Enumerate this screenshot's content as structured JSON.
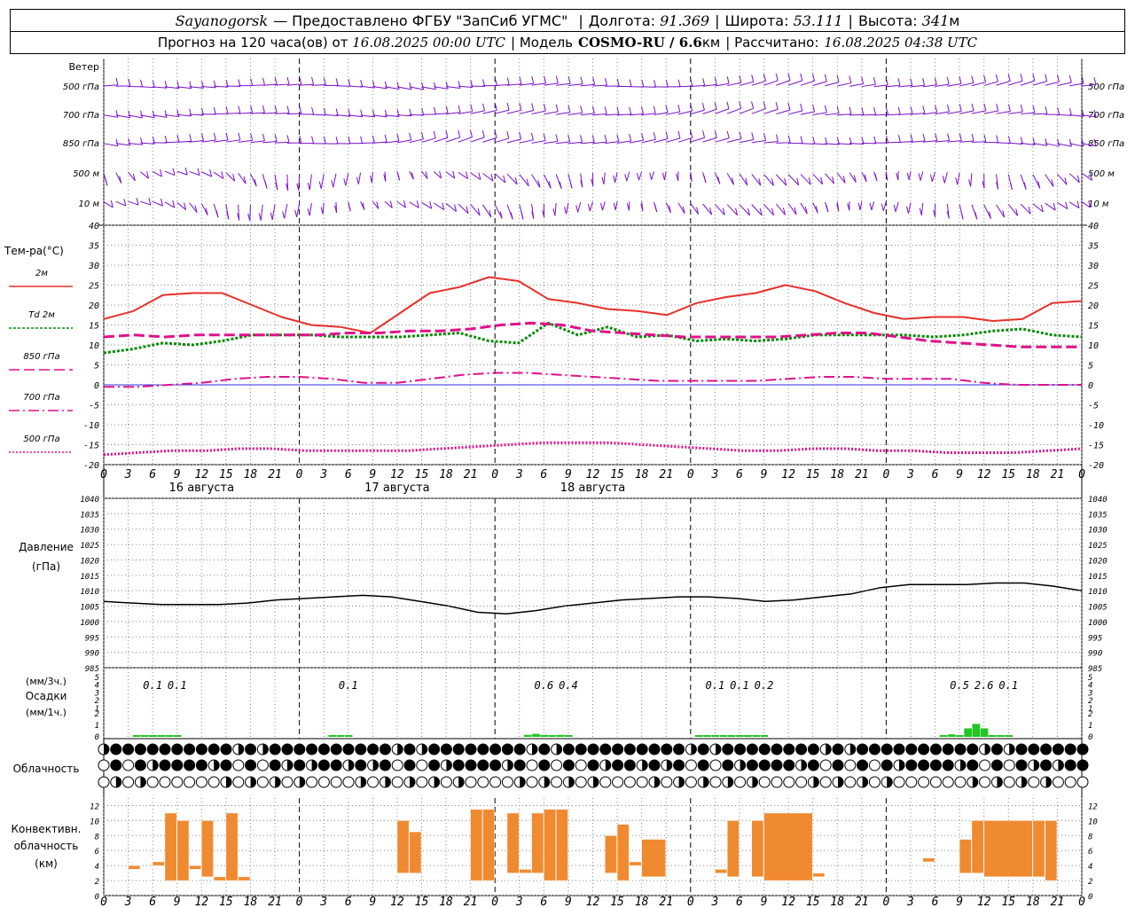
{
  "header": {
    "station": "Sayanogorsk",
    "provider": "— Предоставлено ФГБУ \"ЗапСиб УГМС\"",
    "lon_label": "Долгота:",
    "lon_value": "91.369",
    "lat_label": "Широта:",
    "lat_value": "53.111",
    "alt_label": "Высота:",
    "alt_value": "341",
    "alt_unit": "м",
    "forecast_label": "Прогноз на 120 часа(ов) от",
    "forecast_start": "16.08.2025 00:00 UTC",
    "model_label": "| Модель",
    "model_name": "COSMO-RU / 6.6",
    "model_unit": "км",
    "computed_label": "| Рассчитано:",
    "computed_time": "16.08.2025 04:38 UTC"
  },
  "colors": {
    "t2m": "#e8302a",
    "td2m": "#0a8a0a",
    "t850": "#e0108a",
    "t700": "#e0108a",
    "t500": "#e0108a",
    "wind": "#7a10c8",
    "pressure": "#000000",
    "precip": "#22c522",
    "convective": "#f08a30",
    "zero_line": "#3030e0",
    "grid": "#888888"
  },
  "time_axis": {
    "hour_labels": [
      "0",
      "3",
      "6",
      "9",
      "12",
      "15",
      "18",
      "21",
      "0",
      "3",
      "6",
      "9",
      "12",
      "15",
      "18",
      "21",
      "0",
      "3",
      "6",
      "9",
      "12",
      "15",
      "18",
      "21",
      "0",
      "3",
      "6"
    ],
    "day_labels": [
      "16 августа",
      "17 августа",
      "18 августа"
    ]
  },
  "wind_panel": {
    "title": "Ветер",
    "levels_left": [
      "500 гПа",
      "700 гПа",
      "850 гПа",
      "500 м",
      "10 м"
    ],
    "levels_right": [
      "500 гПа",
      "700 гПа",
      "850 гПа",
      "500 м",
      "10 м"
    ]
  },
  "temp_panel": {
    "title": "Тем-ра(°C)",
    "legend": [
      "2м",
      "Td 2м",
      "850 гПа",
      "700 гПа",
      "500 гПа"
    ],
    "yticks": [
      "40",
      "35",
      "30",
      "25",
      "20",
      "15",
      "10",
      "5",
      "0",
      "-5",
      "-10",
      "-15",
      "-20"
    ]
  },
  "pressure_panel": {
    "title_1": "Давление",
    "title_2": "(гПа)",
    "yticks": [
      "1040",
      "1035",
      "1030",
      "1025",
      "1020",
      "1015",
      "1010",
      "1005",
      "1000",
      "995",
      "990",
      "985"
    ]
  },
  "precip_panel": {
    "label_1": "(мм/3ч.)",
    "label_2": "Осадки",
    "label_3": "(мм/1ч.)",
    "ticks_3h": [
      "5",
      "4",
      "3",
      "2",
      "1"
    ],
    "ticks_1h": [
      "2",
      "1",
      "0"
    ],
    "amounts": [
      {
        "hour": 6,
        "text": "0.1"
      },
      {
        "hour": 9,
        "text": "0.1"
      },
      {
        "hour": 30,
        "text": "0.1"
      },
      {
        "hour": 54,
        "text": "0.6"
      },
      {
        "hour": 57,
        "text": "0.4"
      },
      {
        "hour": 75,
        "text": "0.1"
      },
      {
        "hour": 78,
        "text": "0.1"
      },
      {
        "hour": 81,
        "text": "0.2"
      },
      {
        "hour": 105,
        "text": "0.5"
      },
      {
        "hour": 108,
        "text": "2.6"
      },
      {
        "hour": 111,
        "text": "0.1"
      }
    ]
  },
  "cloud_panel": {
    "title": "Облачность"
  },
  "conv_panel": {
    "label_1": "Конвективн.",
    "label_2": "облачность",
    "label_3": "(км)",
    "yticks": [
      "12",
      "10",
      "8",
      "6",
      "4",
      "2",
      "0"
    ]
  },
  "chart_data": {
    "type": "line",
    "x_hours": [
      0,
      3,
      6,
      9,
      12,
      15,
      18,
      21,
      24,
      27,
      30,
      33,
      36,
      39,
      42,
      45,
      48,
      51,
      54,
      57,
      60,
      63,
      66,
      69,
      72,
      75,
      78,
      81,
      84,
      87,
      90,
      93,
      96,
      99,
      102,
      105,
      108,
      111,
      114,
      117,
      120
    ],
    "series": [
      {
        "name": "2м",
        "values": [
          16.5,
          18.5,
          22.5,
          23,
          23,
          20,
          17,
          15,
          14.5,
          13,
          18,
          23,
          24.5,
          27,
          26,
          21.5,
          20.5,
          19,
          18.5,
          17.5,
          20.5,
          22,
          23,
          25,
          23.5,
          20.5,
          18,
          16.5,
          17,
          17,
          16,
          16.5,
          20.5,
          21
        ]
      },
      {
        "name": "Td 2м",
        "values": [
          8,
          9,
          10.5,
          10,
          11,
          12.5,
          12.5,
          12.5,
          12,
          12,
          12,
          12.5,
          13,
          11,
          10.5,
          15.5,
          12.5,
          14.5,
          12,
          12.5,
          11,
          11.5,
          11,
          11.5,
          12.5,
          12.5,
          12.5,
          12.5,
          12,
          12.5,
          13.5,
          14,
          12.5,
          12
        ]
      },
      {
        "name": "850 гПа",
        "values": [
          12,
          12.5,
          12,
          12.5,
          12.5,
          12.5,
          12.5,
          12.5,
          13,
          13,
          13.5,
          13.5,
          14,
          15,
          15.5,
          15,
          13.5,
          13,
          12.5,
          12,
          12,
          12,
          12,
          12.5,
          13,
          13,
          12,
          11,
          10.5,
          10,
          9.5,
          9.5,
          9.5
        ]
      },
      {
        "name": "700 гПа",
        "values": [
          -0.5,
          -0.5,
          0,
          0.5,
          1.5,
          2,
          2,
          1.5,
          0.5,
          0.5,
          1.5,
          2.5,
          3,
          3,
          2.5,
          2,
          1.5,
          1,
          1,
          1,
          1,
          1.5,
          2,
          2,
          1.5,
          1.5,
          1.5,
          0.5,
          0,
          0,
          0
        ]
      },
      {
        "name": "500 гПа",
        "values": [
          -17.5,
          -17,
          -16.5,
          -16.5,
          -16,
          -16,
          -16.5,
          -16.5,
          -16.5,
          -16.5,
          -16,
          -15.5,
          -15,
          -14.5,
          -14.5,
          -14.5,
          -15,
          -15.5,
          -16,
          -16.5,
          -16.5,
          -16,
          -16,
          -16.5,
          -16.5,
          -17,
          -17,
          -17,
          -16.5,
          -16
        ]
      },
      {
        "name": "Давление",
        "values": [
          1006.5,
          1006,
          1005.5,
          1005.5,
          1005.5,
          1006,
          1007,
          1007.5,
          1008,
          1008.5,
          1008,
          1006.5,
          1005,
          1003,
          1002.5,
          1003.5,
          1005,
          1006,
          1007,
          1007.5,
          1008,
          1008,
          1007.5,
          1006.5,
          1007,
          1008,
          1009,
          1011,
          1012,
          1012,
          1012,
          1012.5,
          1012.5,
          1011.5,
          1010
        ]
      }
    ],
    "precip_3h": [
      {
        "hour": 6,
        "value": 0.1
      },
      {
        "hour": 9,
        "value": 0.1
      },
      {
        "hour": 30,
        "value": 0.1
      },
      {
        "hour": 54,
        "value": 0.6
      },
      {
        "hour": 57,
        "value": 0.4
      },
      {
        "hour": 75,
        "value": 0.1
      },
      {
        "hour": 78,
        "value": 0.1
      },
      {
        "hour": 81,
        "value": 0.2
      },
      {
        "hour": 105,
        "value": 0.5
      },
      {
        "hour": 108,
        "value": 2.6
      },
      {
        "hour": 111,
        "value": 0.1
      }
    ],
    "convective_km": [
      {
        "x0": 2,
        "x1": 3,
        "base": 3.5,
        "top": 4
      },
      {
        "x0": 4,
        "x1": 5,
        "base": 4,
        "top": 4.5
      },
      {
        "x0": 5,
        "x1": 6,
        "base": 2,
        "top": 11
      },
      {
        "x0": 6,
        "x1": 7,
        "base": 2,
        "top": 10
      },
      {
        "x0": 7,
        "x1": 8,
        "base": 3.5,
        "top": 4
      },
      {
        "x0": 8,
        "x1": 9,
        "base": 2.5,
        "top": 10
      },
      {
        "x0": 9,
        "x1": 10,
        "base": 2,
        "top": 2.5
      },
      {
        "x0": 10,
        "x1": 11,
        "base": 2,
        "top": 11
      },
      {
        "x0": 11,
        "x1": 12,
        "base": 2,
        "top": 2.5
      },
      {
        "x0": 24,
        "x1": 25,
        "base": 3,
        "top": 10
      },
      {
        "x0": 25,
        "x1": 26,
        "base": 3,
        "top": 8.5
      },
      {
        "x0": 30,
        "x1": 31,
        "base": 2,
        "top": 11.5
      },
      {
        "x0": 31,
        "x1": 32,
        "base": 2,
        "top": 11.5
      },
      {
        "x0": 33,
        "x1": 34,
        "base": 3,
        "top": 11
      },
      {
        "x0": 34,
        "x1": 35,
        "base": 3,
        "top": 3.5
      },
      {
        "x0": 35,
        "x1": 36,
        "base": 3,
        "top": 11
      },
      {
        "x0": 36,
        "x1": 37,
        "base": 2,
        "top": 11.5
      },
      {
        "x0": 37,
        "x1": 38,
        "base": 2,
        "top": 11.5
      },
      {
        "x0": 41,
        "x1": 42,
        "base": 3,
        "top": 8
      },
      {
        "x0": 42,
        "x1": 43,
        "base": 2,
        "top": 9.5
      },
      {
        "x0": 43,
        "x1": 44,
        "base": 4,
        "top": 4.5
      },
      {
        "x0": 44,
        "x1": 46,
        "base": 2.5,
        "top": 7.5
      },
      {
        "x0": 50,
        "x1": 51,
        "base": 3,
        "top": 3.5
      },
      {
        "x0": 51,
        "x1": 52,
        "base": 2.5,
        "top": 10
      },
      {
        "x0": 53,
        "x1": 54,
        "base": 2.5,
        "top": 10
      },
      {
        "x0": 54,
        "x1": 58,
        "base": 2,
        "top": 11
      },
      {
        "x0": 58,
        "x1": 59,
        "base": 2.5,
        "top": 3
      },
      {
        "x0": 67,
        "x1": 68,
        "base": 4.5,
        "top": 5
      },
      {
        "x0": 70,
        "x1": 71,
        "base": 3,
        "top": 7.5
      },
      {
        "x0": 71,
        "x1": 72,
        "base": 3,
        "top": 10
      },
      {
        "x0": 72,
        "x1": 76,
        "base": 2.5,
        "top": 10
      },
      {
        "x0": 76,
        "x1": 77,
        "base": 2.5,
        "top": 10
      },
      {
        "x0": 77,
        "x1": 78,
        "base": 2,
        "top": 10
      }
    ],
    "temp_ylim": [
      -20,
      40
    ],
    "pressure_ylim": [
      985,
      1040
    ],
    "convective_ylim": [
      0,
      13
    ],
    "grid": true
  }
}
